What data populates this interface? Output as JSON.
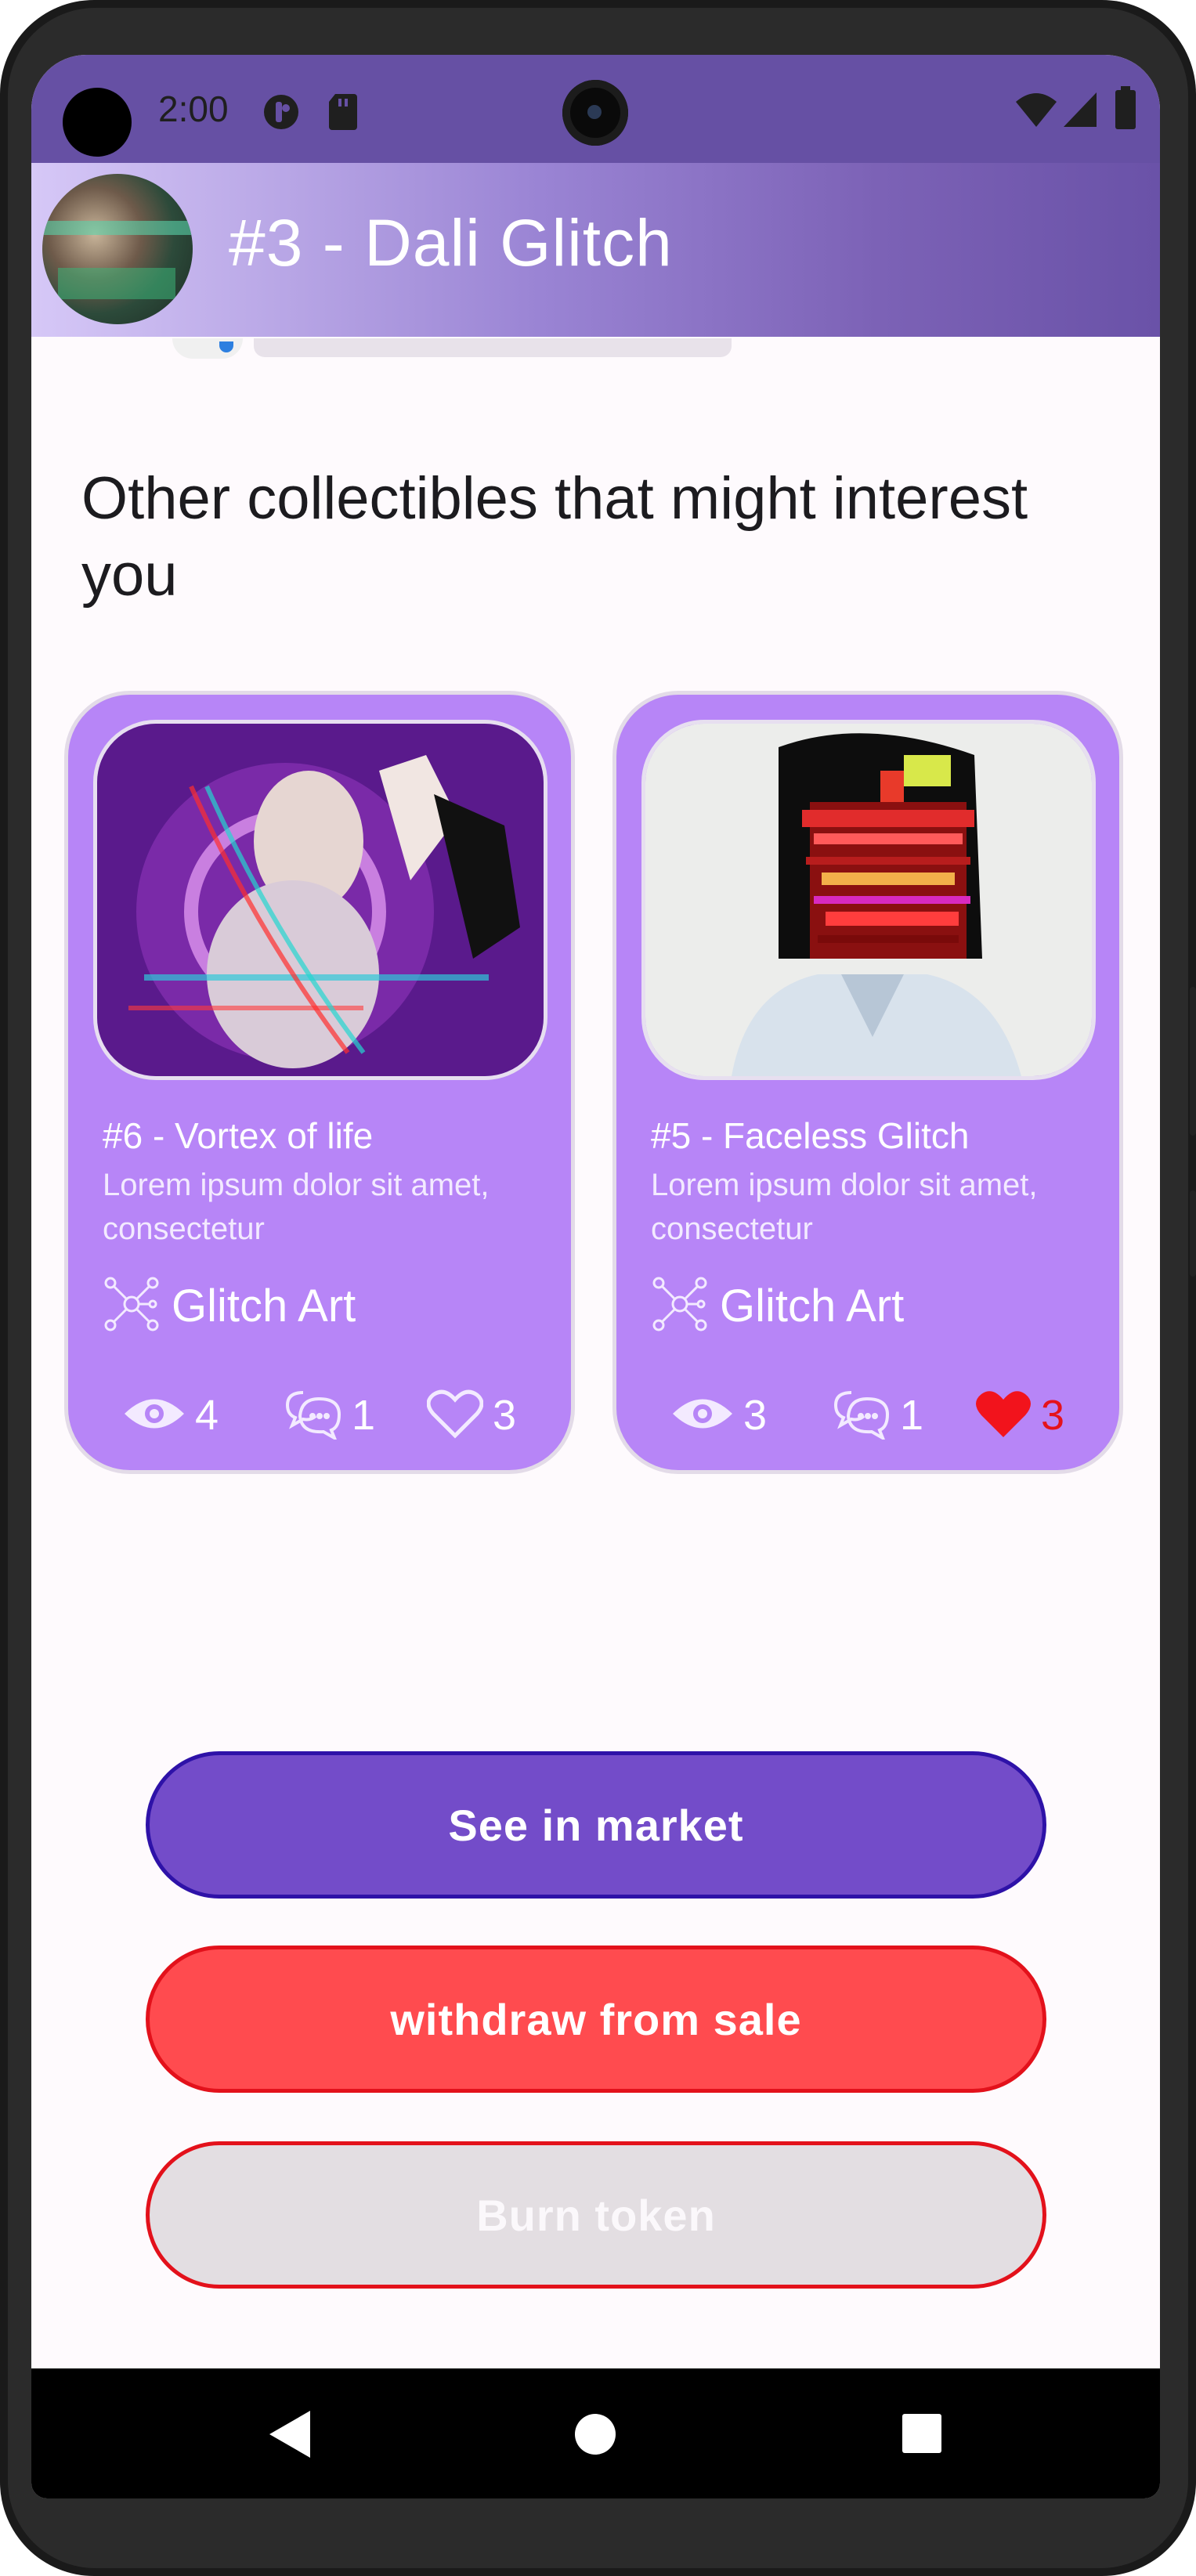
{
  "status_bar": {
    "time": "2:00",
    "icons": [
      "media-icon",
      "sd-card-icon",
      "wifi-icon",
      "signal-icon",
      "battery-icon"
    ]
  },
  "header": {
    "title": "#3 - Dali Glitch"
  },
  "section": {
    "title": "Other collectibles that might interest you"
  },
  "cards": [
    {
      "title": "#6 - Vortex of life",
      "description": "Lorem ipsum dolor sit amet, consectetur",
      "category": "Glitch Art",
      "views": "4",
      "comments": "1",
      "likes": "3",
      "liked": false
    },
    {
      "title": "#5 - Faceless Glitch",
      "description": "Lorem ipsum dolor sit amet, consectetur",
      "category": "Glitch Art",
      "views": "3",
      "comments": "1",
      "likes": "3",
      "liked": true
    }
  ],
  "buttons": {
    "see_in_market": "See in market",
    "withdraw": "withdraw from sale",
    "burn": "Burn token"
  },
  "colors": {
    "status_bar": "#6650a4",
    "card": "#b785f7",
    "primary_button": "#734cc9",
    "danger_button": "#ff4b4f",
    "liked_heart": "#e5121b"
  }
}
